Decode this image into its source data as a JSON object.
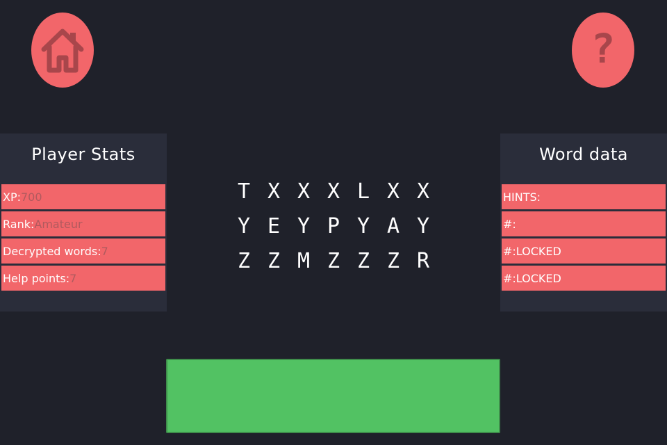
{
  "buttons": {
    "home_icon": "home-icon",
    "help_icon": "question-mark-icon",
    "help_glyph": "?",
    "color": "#f2666a"
  },
  "stats": {
    "title": "Player Stats",
    "xp_label": "XP:",
    "xp_value": "700",
    "rank_label": "Rank:",
    "rank_value": "Amateur",
    "decrypted_label": "Decrypted words:",
    "decrypted_value": "7",
    "help_label": "Help points:",
    "help_value": "7"
  },
  "word": {
    "title": "Word data",
    "hints_label": "HINTS:",
    "slot1_label": "#:",
    "slot2_label": "#:LOCKED",
    "slot3_label": "#:LOCKED"
  },
  "grid": [
    [
      "T",
      "X",
      "X",
      "X",
      "L",
      "X",
      "X"
    ],
    [
      "Y",
      "E",
      "Y",
      "P",
      "Y",
      "A",
      "Y"
    ],
    [
      "Z",
      "Z",
      "M",
      "Z",
      "Z",
      "Z",
      "R"
    ]
  ],
  "answer": {
    "value": "",
    "color": "#52c263"
  }
}
